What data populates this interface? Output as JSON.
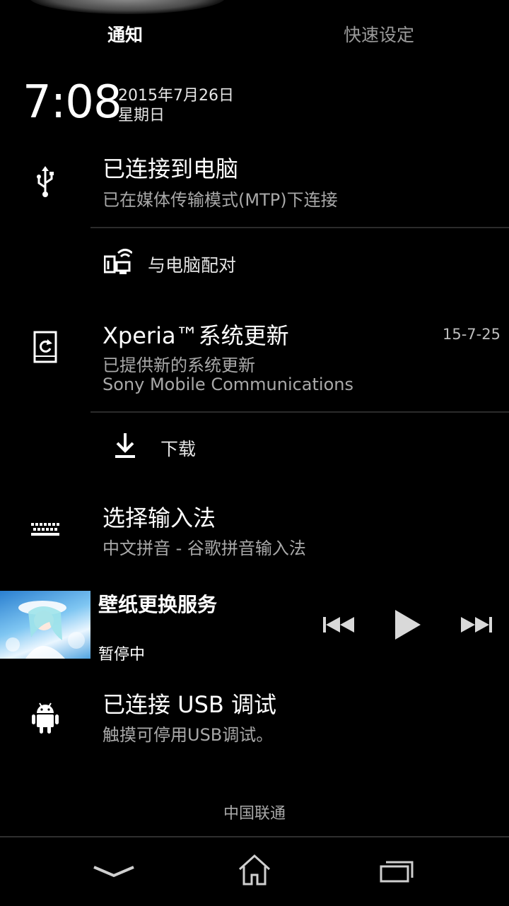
{
  "tabs": {
    "notifications": "通知",
    "quick_settings": "快速设定"
  },
  "header": {
    "time": "7:08",
    "date": "2015年7月26日",
    "weekday": "星期日"
  },
  "notifications": [
    {
      "icon": "usb-icon",
      "title": "已连接到电脑",
      "subtitle": "已在媒体传输模式(MTP)下连接"
    },
    {
      "icon": "pair-pc-icon",
      "label": "与电脑配对"
    },
    {
      "icon": "system-update-icon",
      "title": "Xperia™系统更新",
      "subtitle": "已提供新的系统更新",
      "subtitle2": "Sony Mobile Communications",
      "time": "15-7-25"
    },
    {
      "icon": "download-icon",
      "label": "下载"
    },
    {
      "icon": "keyboard-icon",
      "title": "选择输入法",
      "subtitle": "中文拼音 - 谷歌拼音输入法"
    }
  ],
  "media": {
    "title": "壁纸更换服务",
    "status": "暂停中"
  },
  "debug": {
    "icon": "android-icon",
    "title": "已连接 USB 调试",
    "subtitle": "触摸可停用USB调试。"
  },
  "carrier": "中国联通",
  "nav": [
    "chevron-down-icon",
    "home-icon",
    "recents-icon"
  ]
}
